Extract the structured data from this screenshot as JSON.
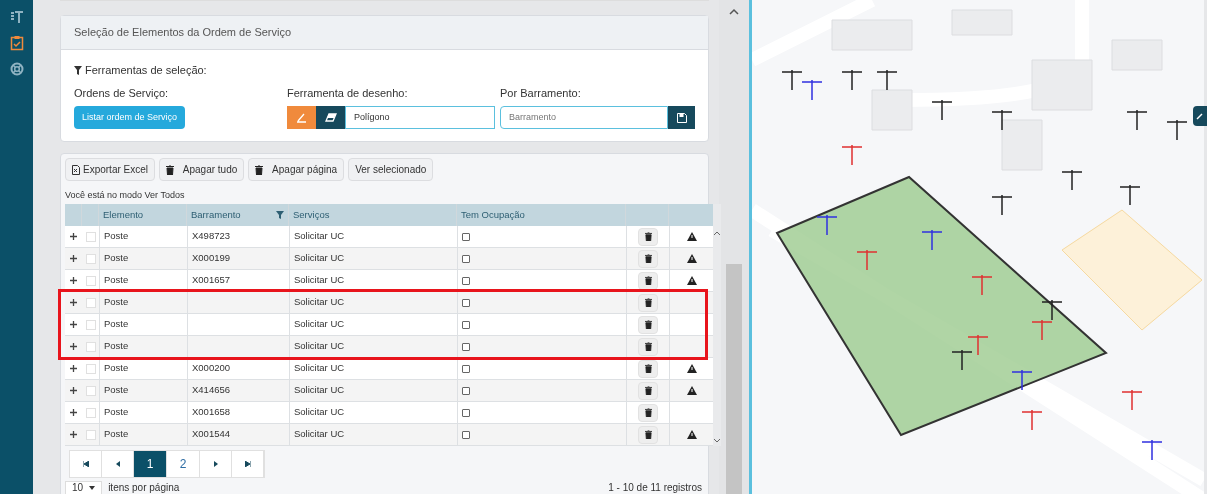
{
  "selection_panel": {
    "title": "Seleção de Elementos da Ordem de Serviço",
    "tools_label": "Ferramentas de seleção:",
    "orders": {
      "label": "Ordens de Serviço:",
      "button": "Listar ordem de Serviço"
    },
    "drawing": {
      "label": "Ferramenta de desenho:",
      "value": "Polígono",
      "tools": [
        {
          "kind": "pen",
          "selected": true
        },
        {
          "kind": "eraser",
          "selected": false
        }
      ]
    },
    "bus": {
      "label": "Por Barramento:",
      "placeholder": "Barramento"
    }
  },
  "toolbar": [
    {
      "kind": "excel",
      "label": "Exportar Excel"
    },
    {
      "kind": "trash",
      "label": "Apagar tudo"
    },
    {
      "kind": "trash",
      "label": "Apagar página"
    },
    {
      "kind": "plain",
      "label": "Ver selecionado"
    }
  ],
  "mode_text": "Você está no modo Ver Todos",
  "table": {
    "columns": [
      "Elemento",
      "Barramento",
      "Serviços",
      "Tem Ocupação"
    ],
    "rows": [
      {
        "selected": false,
        "elemento": "Poste",
        "barramento": "X498723",
        "servicos": "Solicitar UC",
        "ocupacao": false,
        "warning": true,
        "highlighted": false
      },
      {
        "selected": false,
        "elemento": "Poste",
        "barramento": "X000199",
        "servicos": "Solicitar UC",
        "ocupacao": false,
        "warning": true,
        "highlighted": false
      },
      {
        "selected": false,
        "elemento": "Poste",
        "barramento": "X001657",
        "servicos": "Solicitar UC",
        "ocupacao": false,
        "warning": true,
        "highlighted": false
      },
      {
        "selected": false,
        "elemento": "Poste",
        "barramento": "",
        "servicos": "Solicitar UC",
        "ocupacao": false,
        "warning": false,
        "highlighted": true
      },
      {
        "selected": false,
        "elemento": "Poste",
        "barramento": "",
        "servicos": "Solicitar UC",
        "ocupacao": false,
        "warning": false,
        "highlighted": true
      },
      {
        "selected": false,
        "elemento": "Poste",
        "barramento": "",
        "servicos": "Solicitar UC",
        "ocupacao": false,
        "warning": false,
        "highlighted": true
      },
      {
        "selected": false,
        "elemento": "Poste",
        "barramento": "X000200",
        "servicos": "Solicitar UC",
        "ocupacao": false,
        "warning": true,
        "highlighted": false
      },
      {
        "selected": false,
        "elemento": "Poste",
        "barramento": "X414656",
        "servicos": "Solicitar UC",
        "ocupacao": false,
        "warning": true,
        "highlighted": false
      },
      {
        "selected": false,
        "elemento": "Poste",
        "barramento": "X001658",
        "servicos": "Solicitar UC",
        "ocupacao": false,
        "warning": false,
        "highlighted": false
      },
      {
        "selected": false,
        "elemento": "Poste",
        "barramento": "X001544",
        "servicos": "Solicitar UC",
        "ocupacao": false,
        "warning": true,
        "highlighted": false
      }
    ]
  },
  "pagination": {
    "pages": [
      {
        "label": "1",
        "selected": true
      },
      {
        "label": "2",
        "selected": false
      }
    ],
    "page_size": "10",
    "page_size_label": "itens por página",
    "range": "1 - 10 de 11 registros"
  }
}
